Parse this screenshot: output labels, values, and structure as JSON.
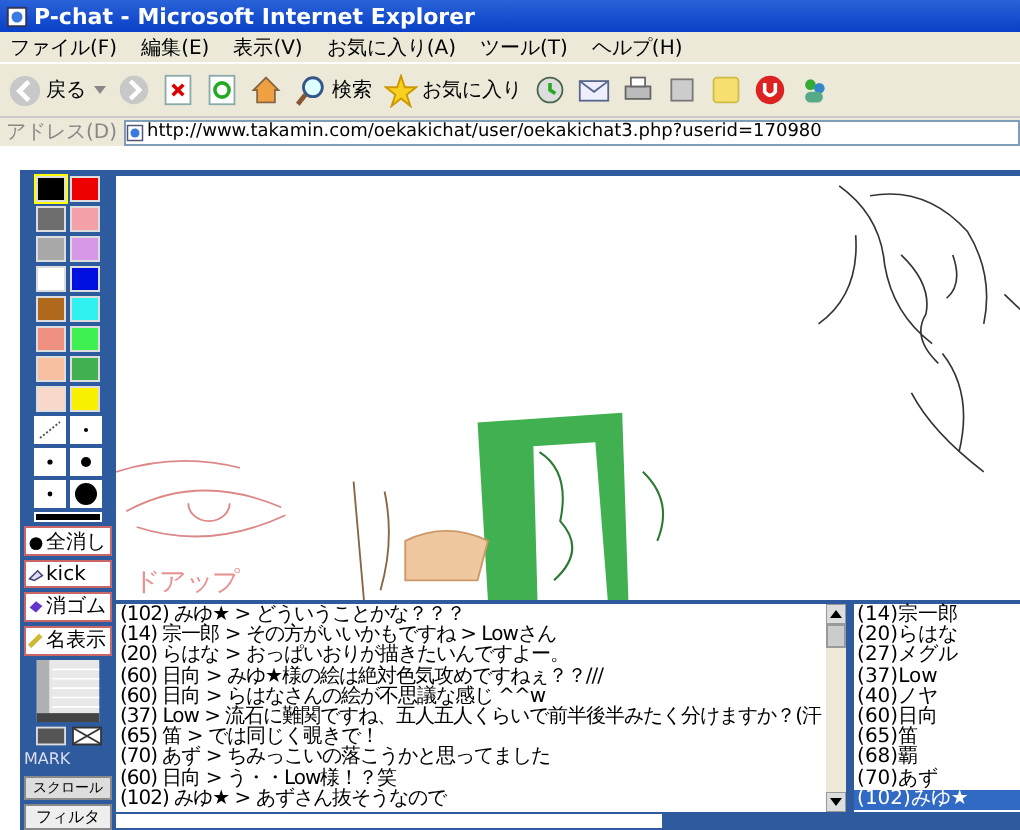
{
  "window": {
    "title": "P-chat - Microsoft Internet Explorer"
  },
  "menu": [
    "ファイル(F)",
    "編集(E)",
    "表示(V)",
    "お気に入り(A)",
    "ツール(T)",
    "ヘルプ(H)"
  ],
  "toolbar": {
    "back": "戻る",
    "search": "検索",
    "favorites": "お気に入り"
  },
  "address": {
    "label": "アドレス(D)",
    "url": "http://www.takamin.com/oekakichat/user/oekakichat3.php?userid=170980"
  },
  "palette": {
    "swatches": [
      {
        "color": "#000000",
        "selected": true
      },
      {
        "color": "#ee0000",
        "selected": false
      },
      {
        "color": "#6e6e6e",
        "selected": false
      },
      {
        "color": "#f4a0a8",
        "selected": false
      },
      {
        "color": "#a8a8a8",
        "selected": false
      },
      {
        "color": "#d898e8",
        "selected": false
      },
      {
        "color": "#ffffff",
        "selected": false
      },
      {
        "color": "#0010e0",
        "selected": false
      },
      {
        "color": "#b0681c",
        "selected": false
      },
      {
        "color": "#30f0f0",
        "selected": false
      },
      {
        "color": "#f09080",
        "selected": false
      },
      {
        "color": "#40f050",
        "selected": false
      },
      {
        "color": "#f8c0a0",
        "selected": false
      },
      {
        "color": "#40b050",
        "selected": false
      },
      {
        "color": "#f8d8c8",
        "selected": false
      },
      {
        "color": "#f8f000",
        "selected": false
      }
    ],
    "buttons": [
      "全消し",
      "kick",
      "消ゴム",
      "名表示"
    ],
    "mark_label": "MARK",
    "scroll_button": "スクロール",
    "filter_button": "フィルタ"
  },
  "canvas": {
    "caption": "ドアップ"
  },
  "chat": {
    "messages": [
      "(102) みゆ★ > どういうことかな？？？",
      "(14) 宗一郎 > その方がいいかもですね > Lowさん",
      "(20) らはな > おっぱいおりが描きたいんですよー。",
      "(60) 日向 > みゆ★様の絵は絶対色気攻めですねぇ？？///",
      "(60) 日向 > らはなさんの絵が不思議な感じ ^^w",
      "(37) Low > 流石に難関ですね、五人五人くらいで前半後半みたく分けますか？(汗",
      "(65) 笛 > では同じく覗きで！",
      "(70) あず > ちみっこいの落こうかと思ってました",
      "(60) 日向 > う・・Low様！？笑",
      "(102) みゆ★ > あずさん抜そうなので"
    ]
  },
  "users": [
    {
      "name": "(14)宗一郎",
      "selected": false
    },
    {
      "name": "(20)らはな",
      "selected": false
    },
    {
      "name": "(27)メグル",
      "selected": false
    },
    {
      "name": "(37)Low",
      "selected": false
    },
    {
      "name": "(40)ノヤ",
      "selected": false
    },
    {
      "name": "(60)日向",
      "selected": false
    },
    {
      "name": "(65)笛",
      "selected": false
    },
    {
      "name": "(68)覇",
      "selected": false
    },
    {
      "name": "(70)あず",
      "selected": false
    },
    {
      "name": "(102)みゆ★",
      "selected": true
    }
  ]
}
